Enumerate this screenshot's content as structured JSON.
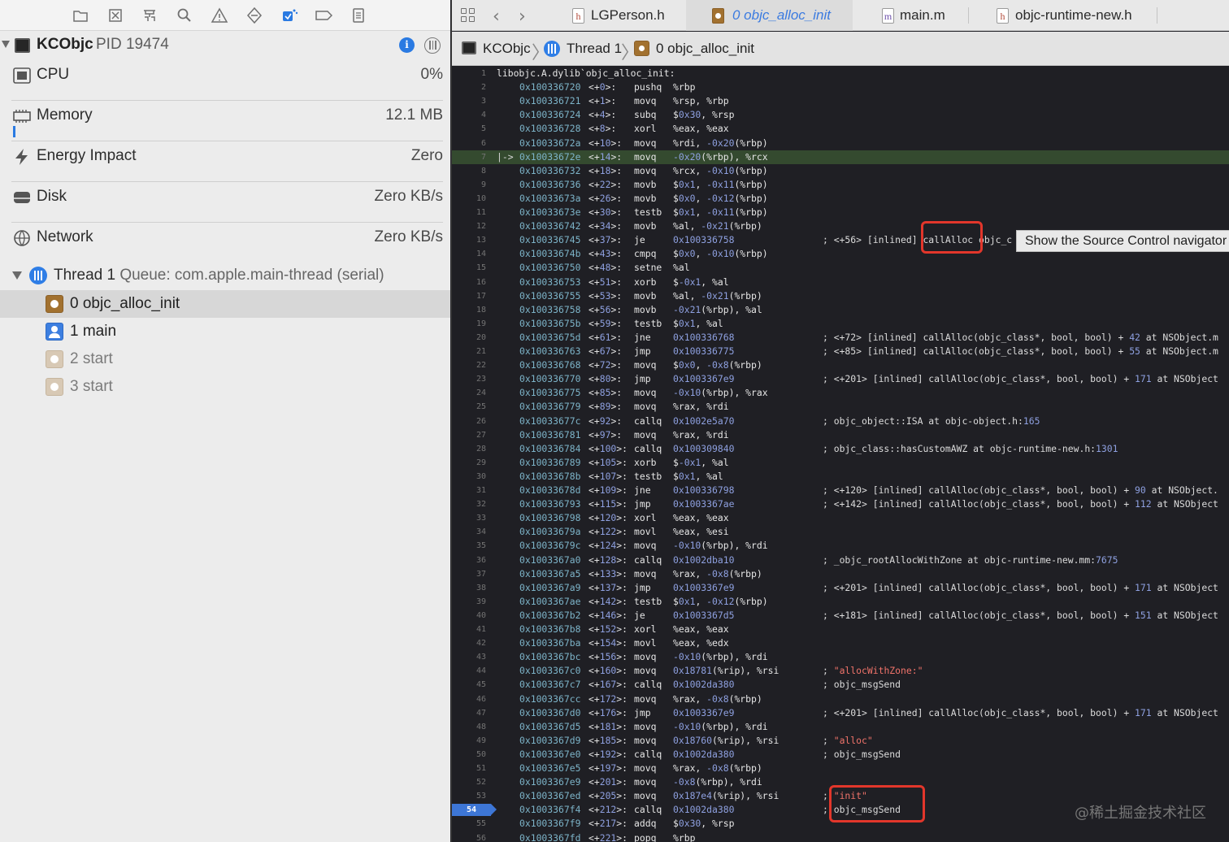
{
  "navigator": {
    "toolbar_icons": [
      "folder-icon",
      "source-control-icon",
      "symbol-icon",
      "find-icon",
      "issue-icon",
      "test-icon",
      "debug-icon",
      "breakpoint-icon",
      "report-icon"
    ],
    "process": {
      "name": "KCObjc",
      "pid_label": "PID 19474"
    },
    "gauges": [
      {
        "label": "CPU",
        "value": "0%",
        "icon": "cpu-icon"
      },
      {
        "label": "Memory",
        "value": "12.1 MB",
        "icon": "memory-icon"
      },
      {
        "label": "Energy Impact",
        "value": "Zero",
        "icon": "energy-icon"
      },
      {
        "label": "Disk",
        "value": "Zero KB/s",
        "icon": "disk-icon"
      },
      {
        "label": "Network",
        "value": "Zero KB/s",
        "icon": "network-icon"
      }
    ],
    "thread": {
      "name": "Thread 1",
      "queue": "Queue: com.apple.main-thread (serial)"
    },
    "frames": [
      {
        "label": "0 objc_alloc_init",
        "selected": true
      },
      {
        "label": "1 main",
        "selected": false
      },
      {
        "label": "2 start",
        "selected": false
      },
      {
        "label": "3 start",
        "selected": false
      }
    ]
  },
  "editor": {
    "tabs": [
      {
        "label": "LGPerson.h",
        "icon": "header-file-icon",
        "glyph": "h"
      },
      {
        "label": "0 objc_alloc_init",
        "icon": "stack-frame-icon",
        "glyph": ""
      },
      {
        "label": "main.m",
        "icon": "implementation-file-icon",
        "glyph": "m"
      },
      {
        "label": "objc-runtime-new.h",
        "icon": "header-file-icon",
        "glyph": "h"
      }
    ],
    "jump_bar": {
      "process": "KCObjc",
      "thread": "Thread 1",
      "frame": "0 objc_alloc_init"
    },
    "tooltip": "Show the Source Control navigator",
    "watermark": "@稀土掘金技术社区",
    "header_line": "libobjc.A.dylib`objc_alloc_init:",
    "current_line": 7,
    "pc_line": 54,
    "lines": [
      {
        "n": "2",
        "addr": "0x100336720",
        "off": "<+0>:",
        "op": "pushq",
        "args": "%rbp",
        "cm": ""
      },
      {
        "n": "3",
        "addr": "0x100336721",
        "off": "<+1>:",
        "op": "movq",
        "args": "%rsp, %rbp",
        "cm": ""
      },
      {
        "n": "4",
        "addr": "0x100336724",
        "off": "<+4>:",
        "op": "subq",
        "args": "$0x30, %rsp",
        "cm": ""
      },
      {
        "n": "5",
        "addr": "0x100336728",
        "off": "<+8>:",
        "op": "xorl",
        "args": "%eax, %eax",
        "cm": ""
      },
      {
        "n": "6",
        "addr": "0x10033672a",
        "off": "<+10>:",
        "op": "movq",
        "args": "%rdi, -0x20(%rbp)",
        "cm": ""
      },
      {
        "n": "7",
        "addr": "0x10033672e",
        "off": "<+14>:",
        "op": "movq",
        "args": "-0x20(%rbp), %rcx",
        "cm": "",
        "marker": "|->"
      },
      {
        "n": "8",
        "addr": "0x100336732",
        "off": "<+18>:",
        "op": "movq",
        "args": "%rcx, -0x10(%rbp)",
        "cm": ""
      },
      {
        "n": "9",
        "addr": "0x100336736",
        "off": "<+22>:",
        "op": "movb",
        "args": "$0x1, -0x11(%rbp)",
        "cm": ""
      },
      {
        "n": "10",
        "addr": "0x10033673a",
        "off": "<+26>:",
        "op": "movb",
        "args": "$0x0, -0x12(%rbp)",
        "cm": ""
      },
      {
        "n": "11",
        "addr": "0x10033673e",
        "off": "<+30>:",
        "op": "testb",
        "args": "$0x1, -0x11(%rbp)",
        "cm": ""
      },
      {
        "n": "12",
        "addr": "0x100336742",
        "off": "<+34>:",
        "op": "movb",
        "args": "%al, -0x21(%rbp)",
        "cm": ""
      },
      {
        "n": "13",
        "addr": "0x100336745",
        "off": "<+37>:",
        "op": "je",
        "args": "0x100336758",
        "cm": "; <+56> [inlined] callAlloc objc_c"
      },
      {
        "n": "14",
        "addr": "0x10033674b",
        "off": "<+43>:",
        "op": "cmpq",
        "args": "$0x0, -0x10(%rbp)",
        "cm": ""
      },
      {
        "n": "15",
        "addr": "0x100336750",
        "off": "<+48>:",
        "op": "setne",
        "args": "%al",
        "cm": ""
      },
      {
        "n": "16",
        "addr": "0x100336753",
        "off": "<+51>:",
        "op": "xorb",
        "args": "$-0x1, %al",
        "cm": ""
      },
      {
        "n": "17",
        "addr": "0x100336755",
        "off": "<+53>:",
        "op": "movb",
        "args": "%al, -0x21(%rbp)",
        "cm": ""
      },
      {
        "n": "18",
        "addr": "0x100336758",
        "off": "<+56>:",
        "op": "movb",
        "args": "-0x21(%rbp), %al",
        "cm": ""
      },
      {
        "n": "19",
        "addr": "0x10033675b",
        "off": "<+59>:",
        "op": "testb",
        "args": "$0x1, %al",
        "cm": ""
      },
      {
        "n": "20",
        "addr": "0x10033675d",
        "off": "<+61>:",
        "op": "jne",
        "args": "0x100336768",
        "cm": "; <+72> [inlined] callAlloc(objc_class*, bool, bool) + 42 at NSObject.m"
      },
      {
        "n": "21",
        "addr": "0x100336763",
        "off": "<+67>:",
        "op": "jmp",
        "args": "0x100336775",
        "cm": "; <+85> [inlined] callAlloc(objc_class*, bool, bool) + 55 at NSObject.m"
      },
      {
        "n": "22",
        "addr": "0x100336768",
        "off": "<+72>:",
        "op": "movq",
        "args": "$0x0, -0x8(%rbp)",
        "cm": ""
      },
      {
        "n": "23",
        "addr": "0x100336770",
        "off": "<+80>:",
        "op": "jmp",
        "args": "0x1003367e9",
        "cm": "; <+201> [inlined] callAlloc(objc_class*, bool, bool) + 171 at NSObject"
      },
      {
        "n": "24",
        "addr": "0x100336775",
        "off": "<+85>:",
        "op": "movq",
        "args": "-0x10(%rbp), %rax",
        "cm": ""
      },
      {
        "n": "25",
        "addr": "0x100336779",
        "off": "<+89>:",
        "op": "movq",
        "args": "%rax, %rdi",
        "cm": ""
      },
      {
        "n": "26",
        "addr": "0x10033677c",
        "off": "<+92>:",
        "op": "callq",
        "args": "0x1002e5a70",
        "cm": "; objc_object::ISA at objc-object.h:165"
      },
      {
        "n": "27",
        "addr": "0x100336781",
        "off": "<+97>:",
        "op": "movq",
        "args": "%rax, %rdi",
        "cm": ""
      },
      {
        "n": "28",
        "addr": "0x100336784",
        "off": "<+100>:",
        "op": "callq",
        "args": "0x100309840",
        "cm": "; objc_class::hasCustomAWZ at objc-runtime-new.h:1301"
      },
      {
        "n": "29",
        "addr": "0x100336789",
        "off": "<+105>:",
        "op": "xorb",
        "args": "$-0x1, %al",
        "cm": ""
      },
      {
        "n": "30",
        "addr": "0x10033678b",
        "off": "<+107>:",
        "op": "testb",
        "args": "$0x1, %al",
        "cm": ""
      },
      {
        "n": "31",
        "addr": "0x10033678d",
        "off": "<+109>:",
        "op": "jne",
        "args": "0x100336798",
        "cm": "; <+120> [inlined] callAlloc(objc_class*, bool, bool) + 90 at NSObject."
      },
      {
        "n": "32",
        "addr": "0x100336793",
        "off": "<+115>:",
        "op": "jmp",
        "args": "0x1003367ae",
        "cm": "; <+142> [inlined] callAlloc(objc_class*, bool, bool) + 112 at NSObject"
      },
      {
        "n": "33",
        "addr": "0x100336798",
        "off": "<+120>:",
        "op": "xorl",
        "args": "%eax, %eax",
        "cm": ""
      },
      {
        "n": "34",
        "addr": "0x10033679a",
        "off": "<+122>:",
        "op": "movl",
        "args": "%eax, %esi",
        "cm": ""
      },
      {
        "n": "35",
        "addr": "0x10033679c",
        "off": "<+124>:",
        "op": "movq",
        "args": "-0x10(%rbp), %rdi",
        "cm": ""
      },
      {
        "n": "36",
        "addr": "0x1003367a0",
        "off": "<+128>:",
        "op": "callq",
        "args": "0x1002dba10",
        "cm": "; _objc_rootAllocWithZone at objc-runtime-new.mm:7675"
      },
      {
        "n": "37",
        "addr": "0x1003367a5",
        "off": "<+133>:",
        "op": "movq",
        "args": "%rax, -0x8(%rbp)",
        "cm": ""
      },
      {
        "n": "38",
        "addr": "0x1003367a9",
        "off": "<+137>:",
        "op": "jmp",
        "args": "0x1003367e9",
        "cm": "; <+201> [inlined] callAlloc(objc_class*, bool, bool) + 171 at NSObject"
      },
      {
        "n": "39",
        "addr": "0x1003367ae",
        "off": "<+142>:",
        "op": "testb",
        "args": "$0x1, -0x12(%rbp)",
        "cm": ""
      },
      {
        "n": "40",
        "addr": "0x1003367b2",
        "off": "<+146>:",
        "op": "je",
        "args": "0x1003367d5",
        "cm": "; <+181> [inlined] callAlloc(objc_class*, bool, bool) + 151 at NSObject"
      },
      {
        "n": "41",
        "addr": "0x1003367b8",
        "off": "<+152>:",
        "op": "xorl",
        "args": "%eax, %eax",
        "cm": ""
      },
      {
        "n": "42",
        "addr": "0x1003367ba",
        "off": "<+154>:",
        "op": "movl",
        "args": "%eax, %edx",
        "cm": ""
      },
      {
        "n": "43",
        "addr": "0x1003367bc",
        "off": "<+156>:",
        "op": "movq",
        "args": "-0x10(%rbp), %rdi",
        "cm": ""
      },
      {
        "n": "44",
        "addr": "0x1003367c0",
        "off": "<+160>:",
        "op": "movq",
        "args": "0x18781(%rip), %rsi",
        "cm": "; \"allocWithZone:\""
      },
      {
        "n": "45",
        "addr": "0x1003367c7",
        "off": "<+167>:",
        "op": "callq",
        "args": "0x1002da380",
        "cm": "; objc_msgSend"
      },
      {
        "n": "46",
        "addr": "0x1003367cc",
        "off": "<+172>:",
        "op": "movq",
        "args": "%rax, -0x8(%rbp)",
        "cm": ""
      },
      {
        "n": "47",
        "addr": "0x1003367d0",
        "off": "<+176>:",
        "op": "jmp",
        "args": "0x1003367e9",
        "cm": "; <+201> [inlined] callAlloc(objc_class*, bool, bool) + 171 at NSObject"
      },
      {
        "n": "48",
        "addr": "0x1003367d5",
        "off": "<+181>:",
        "op": "movq",
        "args": "-0x10(%rbp), %rdi",
        "cm": ""
      },
      {
        "n": "49",
        "addr": "0x1003367d9",
        "off": "<+185>:",
        "op": "movq",
        "args": "0x18760(%rip), %rsi",
        "cm": "; \"alloc\""
      },
      {
        "n": "50",
        "addr": "0x1003367e0",
        "off": "<+192>:",
        "op": "callq",
        "args": "0x1002da380",
        "cm": "; objc_msgSend"
      },
      {
        "n": "51",
        "addr": "0x1003367e5",
        "off": "<+197>:",
        "op": "movq",
        "args": "%rax, -0x8(%rbp)",
        "cm": ""
      },
      {
        "n": "52",
        "addr": "0x1003367e9",
        "off": "<+201>:",
        "op": "movq",
        "args": "-0x8(%rbp), %rdi",
        "cm": ""
      },
      {
        "n": "53",
        "addr": "0x1003367ed",
        "off": "<+205>:",
        "op": "movq",
        "args": "0x187e4(%rip), %rsi",
        "cm": "; \"init\""
      },
      {
        "n": "54",
        "addr": "0x1003367f4",
        "off": "<+212>:",
        "op": "callq",
        "args": "0x1002da380",
        "cm": "; objc_msgSend"
      },
      {
        "n": "55",
        "addr": "0x1003367f9",
        "off": "<+217>:",
        "op": "addq",
        "args": "$0x30, %rsp",
        "cm": ""
      },
      {
        "n": "56",
        "addr": "0x1003367fd",
        "off": "<+221>:",
        "op": "popq",
        "args": "%rbp",
        "cm": ""
      }
    ]
  },
  "colors": {
    "accent": "#2a7ae2",
    "annotation": "#e2362b",
    "current_line": "#344a2f",
    "pc_badge": "#3d76d6"
  }
}
